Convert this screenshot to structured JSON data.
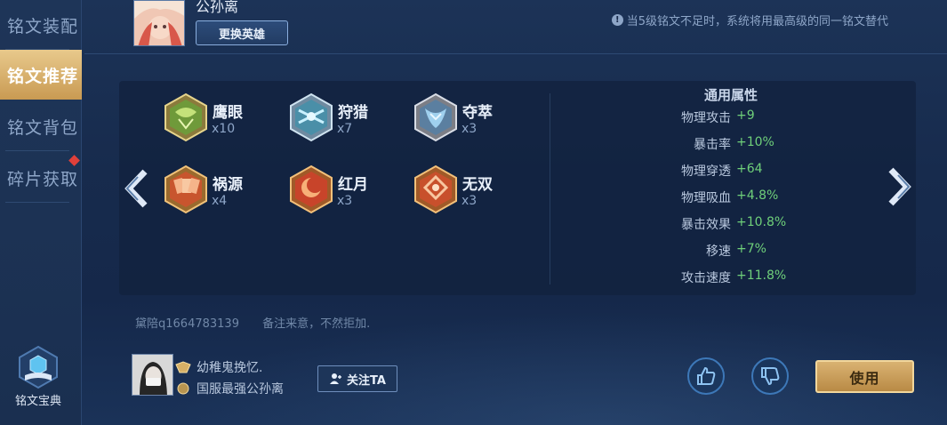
{
  "sidebar": {
    "items": [
      {
        "label": "铭文装配"
      },
      {
        "label": "铭文推荐"
      },
      {
        "label": "铭文背包"
      },
      {
        "label": "碎片获取"
      }
    ],
    "codex_label": "铭文宝典"
  },
  "header": {
    "hero_name": "公孙离",
    "change_hero": "更换英雄",
    "tip": "当5级铭文不足时，系统将用最高级的同一铭文替代"
  },
  "runes": [
    {
      "name": "鹰眼",
      "count": "x10",
      "icon": "hawk-eye-rune-icon",
      "color": "#6f9a3a"
    },
    {
      "name": "狩猎",
      "count": "x7",
      "icon": "hunt-rune-icon",
      "color": "#4a8fa8"
    },
    {
      "name": "夺萃",
      "count": "x3",
      "icon": "seize-rune-icon",
      "color": "#5b7fa0"
    },
    {
      "name": "祸源",
      "count": "x4",
      "icon": "calamity-rune-icon",
      "color": "#c8552e"
    },
    {
      "name": "红月",
      "count": "x3",
      "icon": "red-moon-rune-icon",
      "color": "#c8442a"
    },
    {
      "name": "无双",
      "count": "x3",
      "icon": "peerless-rune-icon",
      "color": "#c8502c"
    }
  ],
  "attributes": {
    "title": "通用属性",
    "rows": [
      {
        "label": "物理攻击",
        "value": "+9"
      },
      {
        "label": "暴击率",
        "value": "+10%"
      },
      {
        "label": "物理穿透",
        "value": "+64"
      },
      {
        "label": "物理吸血",
        "value": "+4.8%"
      },
      {
        "label": "暴击效果",
        "value": "+10.8%"
      },
      {
        "label": "移速",
        "value": "+7%"
      },
      {
        "label": "攻击速度",
        "value": "+11.8%"
      }
    ]
  },
  "author": {
    "contact": "黛陪q1664783139",
    "note": "备注来意，不然拒加."
  },
  "user": {
    "name": "幼稚鬼挽忆.",
    "title": "国服最强公孙离",
    "follow": "关注TA"
  },
  "actions": {
    "use": "使用"
  },
  "colors": {
    "accent_gold": "#d9b272",
    "positive_green": "#6fd07a",
    "active_tab": "#c99a52"
  }
}
